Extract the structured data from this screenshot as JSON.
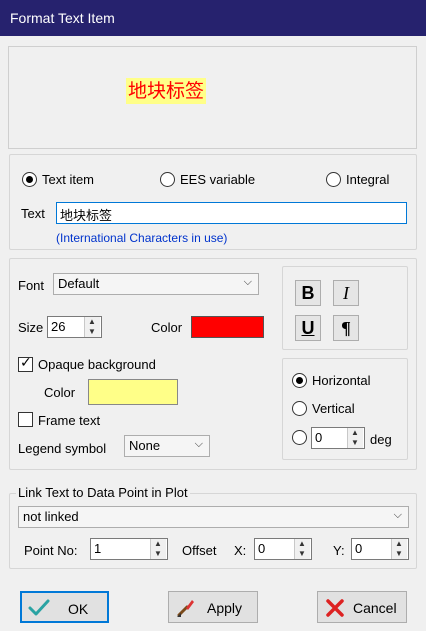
{
  "window": {
    "title": "Format Text Item"
  },
  "preview": {
    "text": "地块标签",
    "text_color": "#ff0000",
    "background": "#ffff88"
  },
  "item_type": {
    "options": [
      "Text item",
      "EES variable",
      "Integral"
    ],
    "selected": "Text item"
  },
  "text_field": {
    "label": "Text",
    "value": "地块标签",
    "note": "(International Characters in use)"
  },
  "font": {
    "label": "Font",
    "value": "Default",
    "size_label": "Size",
    "size": "26",
    "color_label": "Color",
    "color": "#ff0000",
    "styles": {
      "bold": "B",
      "italic": "I",
      "underline": "U",
      "paragraph": "¶"
    }
  },
  "background": {
    "opaque_label": "Opaque background",
    "opaque_checked": true,
    "color_label": "Color",
    "color": "#ffff88",
    "frame_label": "Frame text",
    "frame_checked": false,
    "legend_label": "Legend symbol",
    "legend_value": "None"
  },
  "orientation": {
    "horizontal_label": "Horizontal",
    "vertical_label": "Vertical",
    "selected": "Horizontal",
    "angle": "0",
    "angle_unit": "deg"
  },
  "link": {
    "title": "Link Text to Data Point in Plot",
    "value": "not linked",
    "point_label": "Point No:",
    "point_value": "1",
    "offset_label": "Offset",
    "x_label": "X:",
    "x_value": "0",
    "y_label": "Y:",
    "y_value": "0"
  },
  "buttons": {
    "ok": "OK",
    "apply": "Apply",
    "cancel": "Cancel"
  },
  "colors": {
    "title_bar": "#26226e",
    "focus_blue": "#0078d7"
  }
}
